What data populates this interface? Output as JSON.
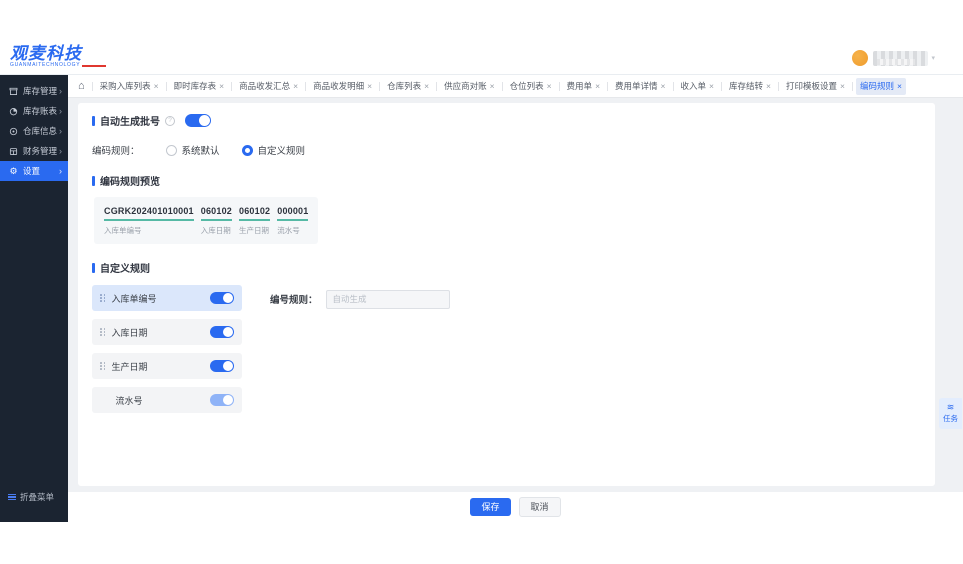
{
  "brand": {
    "logo_text": "观麦科技",
    "logo_sub": "GUANMAITECHNOLOGY"
  },
  "icons": {
    "close": "×",
    "chevron_right": "›",
    "home": "⌂",
    "gear": "⚙",
    "help": "?",
    "caret_down": "▾",
    "task": "≋"
  },
  "sidebar": {
    "items": [
      {
        "label": "库存管理",
        "icon": "inventory-icon",
        "active": false
      },
      {
        "label": "库存账表",
        "icon": "report-icon",
        "active": false
      },
      {
        "label": "仓库信息",
        "icon": "warehouse-info-icon",
        "active": false
      },
      {
        "label": "财务管理",
        "icon": "finance-icon",
        "active": false
      },
      {
        "label": "设置",
        "icon": "gear-icon",
        "active": true
      }
    ],
    "collapse_label": "折叠菜单"
  },
  "tabbar": {
    "tabs": [
      {
        "label": "采购入库列表",
        "active": false
      },
      {
        "label": "即时库存表",
        "active": false
      },
      {
        "label": "商品收发汇总",
        "active": false
      },
      {
        "label": "商品收发明细",
        "active": false
      },
      {
        "label": "仓库列表",
        "active": false
      },
      {
        "label": "供应商对账",
        "active": false
      },
      {
        "label": "仓位列表",
        "active": false
      },
      {
        "label": "费用单",
        "active": false
      },
      {
        "label": "费用单详情",
        "active": false
      },
      {
        "label": "收入单",
        "active": false
      },
      {
        "label": "库存结转",
        "active": false
      },
      {
        "label": "打印模板设置",
        "active": false
      },
      {
        "label": "编码规则",
        "active": true
      }
    ]
  },
  "settings": {
    "auto_batch_title": "自动生成批号",
    "auto_batch_toggle": "on",
    "rule_label": "编码规则：",
    "radio_options": [
      {
        "label": "系统默认",
        "checked": false
      },
      {
        "label": "自定义规则",
        "checked": true
      }
    ],
    "preview_title": "编码规则预览",
    "preview_segments": [
      {
        "code": "CGRK202401010001",
        "label": "入库单编号"
      },
      {
        "code": "060102",
        "label": "入库日期"
      },
      {
        "code": "060102",
        "label": "生产日期"
      },
      {
        "code": "000001",
        "label": "流水号"
      }
    ],
    "custom_title": "自定义规则",
    "custom_rows": [
      {
        "label": "入库单编号",
        "toggle": "on",
        "selected": true,
        "draggable": true
      },
      {
        "label": "入库日期",
        "toggle": "on",
        "selected": false,
        "draggable": true
      },
      {
        "label": "生产日期",
        "toggle": "on",
        "selected": false,
        "draggable": true
      },
      {
        "label": "流水号",
        "toggle": "on-disabled",
        "selected": false,
        "draggable": false
      }
    ],
    "number_rule_label": "编号规则：",
    "number_rule_placeholder": "自动生成"
  },
  "footer": {
    "save_label": "保存",
    "cancel_label": "取消"
  },
  "task_button": {
    "label": "任务"
  },
  "colors": {
    "primary_blue": "#2a6af0",
    "sidebar_bg": "#1b2431",
    "selected_row_bg": "#dbe7fb",
    "row_bg": "#f3f4f6",
    "teal_underline": "#55b9a5",
    "content_bg": "#eff1f4",
    "disabled_toggle": "#8fb3f7",
    "avatar_orange": "#ef9c2d"
  }
}
